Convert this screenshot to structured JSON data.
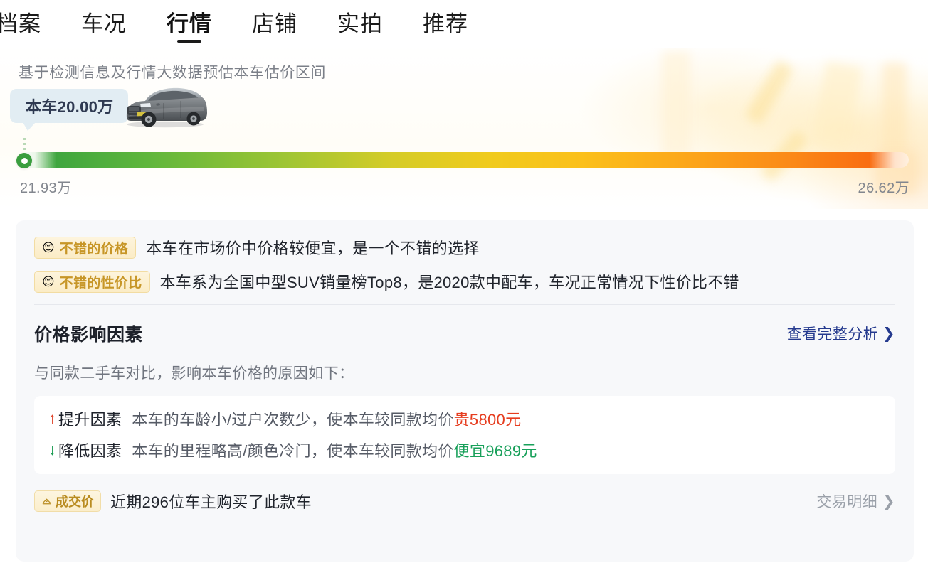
{
  "nav": {
    "tabs": [
      {
        "label": "档案",
        "active": false
      },
      {
        "label": "车况",
        "active": false
      },
      {
        "label": "行情",
        "active": true
      },
      {
        "label": "店铺",
        "active": false
      },
      {
        "label": "实拍",
        "active": false
      },
      {
        "label": "推荐",
        "active": false
      }
    ]
  },
  "hero": {
    "title": "基于检测信息及行情大数据预估本车估价区间",
    "bubble_label": "本车20.00万",
    "car_icon": "suv-car-image",
    "range_low": "21.93万",
    "range_high": "26.62万",
    "marker_icon": "price-position-marker",
    "colors": {
      "bar_start": "#3fa63f",
      "bar_mid": "#f0cb1d",
      "bar_end": "#f96d12",
      "marker": "#3a9e3f",
      "bubble_bg": "#e2edf3"
    }
  },
  "card": {
    "tags": [
      {
        "icon": "smiley-face-icon",
        "label": "不错的价格",
        "text": "本车在市场价中价格较便宜，是一个不错的选择"
      },
      {
        "icon": "smiley-face-icon",
        "label": "不错的性价比",
        "text": "本车系为全国中型SUV销量榜Top8，是2020款中配车，车况正常情况下性价比不错"
      }
    ],
    "section": {
      "title": "价格影响因素",
      "link_label": "查看完整分析",
      "link_chevron": "chevron-right-icon",
      "subtitle": "与同款二手车对比，影响本车价格的原因如下："
    },
    "factors": [
      {
        "arrow": "arrow-up-icon",
        "direction": "up",
        "name": "提升因素",
        "desc": "本车的车龄小/过户次数少，使本车较同款均价",
        "amount": "贵5800元"
      },
      {
        "arrow": "arrow-down-icon",
        "direction": "down",
        "name": "降低因素",
        "desc": "本车的里程略高/颜色冷门，使本车较同款均价",
        "amount": "便宜9689元"
      }
    ],
    "deal": {
      "tag_icon": "handshake-icon",
      "tag_label": "成交价",
      "text": "近期296位车主购买了此款车",
      "link_label": "交易明细",
      "link_chevron": "chevron-right-icon"
    }
  }
}
